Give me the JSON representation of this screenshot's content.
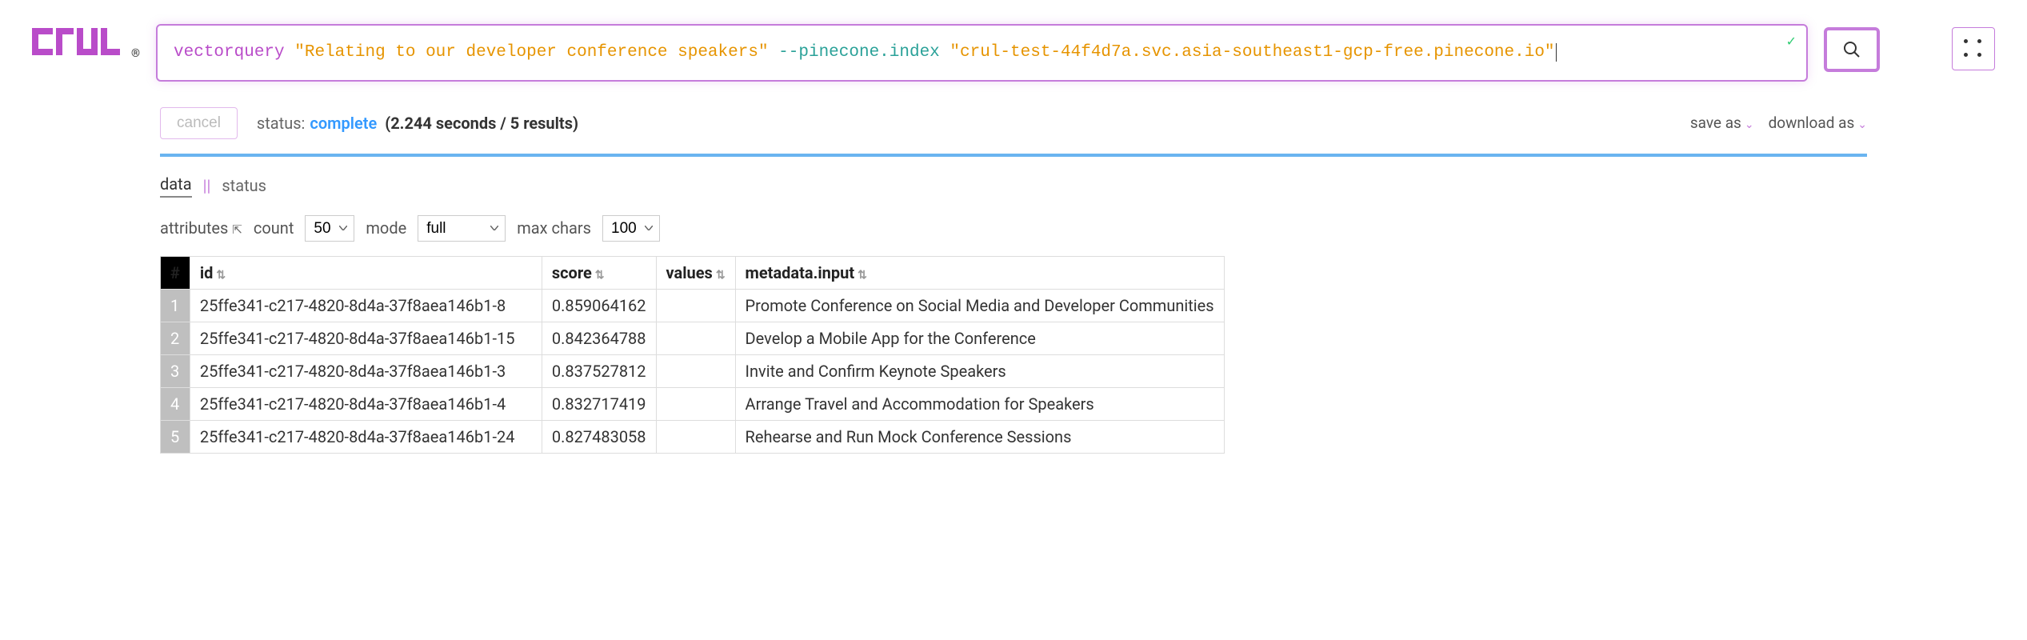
{
  "logo": {
    "text": "crul",
    "registered": "®"
  },
  "query": {
    "command": "vectorquery",
    "string1": "\"Relating to our developer conference speakers\"",
    "flag": "--pinecone.index",
    "string2": "\"crul-test-44f4d7a.svc.asia-southeast1-gcp-free.pinecone.io\""
  },
  "status": {
    "cancel": "cancel",
    "label": "status:",
    "value": "complete",
    "meta": "(2.244 seconds / 5 results)",
    "save_as": "save as",
    "download_as": "download as"
  },
  "tabs": {
    "data": "data",
    "sep": "||",
    "status": "status"
  },
  "controls": {
    "attributes": "attributes",
    "count_label": "count",
    "count_value": "50",
    "mode_label": "mode",
    "mode_value": "full",
    "maxchars_label": "max chars",
    "maxchars_value": "100"
  },
  "columns": {
    "num": "#",
    "id": "id",
    "score": "score",
    "values": "values",
    "meta": "metadata.input"
  },
  "rows": [
    {
      "n": "1",
      "id": "25ffe341-c217-4820-8d4a-37f8aea146b1-8",
      "score": "0.859064162",
      "values": "",
      "meta": "Promote Conference on Social Media and Developer Communities"
    },
    {
      "n": "2",
      "id": "25ffe341-c217-4820-8d4a-37f8aea146b1-15",
      "score": "0.842364788",
      "values": "",
      "meta": "Develop a Mobile App for the Conference"
    },
    {
      "n": "3",
      "id": "25ffe341-c217-4820-8d4a-37f8aea146b1-3",
      "score": "0.837527812",
      "values": "",
      "meta": "Invite and Confirm Keynote Speakers"
    },
    {
      "n": "4",
      "id": "25ffe341-c217-4820-8d4a-37f8aea146b1-4",
      "score": "0.832717419",
      "values": "",
      "meta": "Arrange Travel and Accommodation for Speakers"
    },
    {
      "n": "5",
      "id": "25ffe341-c217-4820-8d4a-37f8aea146b1-24",
      "score": "0.827483058",
      "values": "",
      "meta": "Rehearse and Run Mock Conference Sessions"
    }
  ]
}
